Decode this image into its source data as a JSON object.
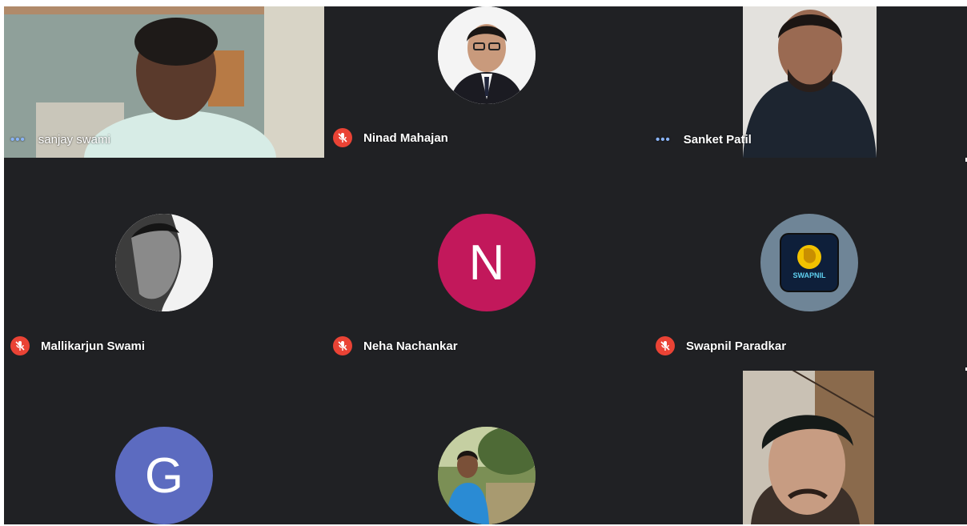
{
  "meeting": {
    "participants": [
      {
        "name": "sanjay swami",
        "status": "speaking",
        "display": "video"
      },
      {
        "name": "Ninad Mahajan",
        "status": "muted",
        "display": "photo"
      },
      {
        "name": "Sanket Patil",
        "status": "speaking",
        "display": "video"
      },
      {
        "name": "Mallikarjun Swami",
        "status": "muted",
        "display": "photo"
      },
      {
        "name": "Neha Nachankar",
        "status": "muted",
        "display": "initial",
        "initial": "N",
        "avatar_color": "#c2185b"
      },
      {
        "name": "Swapnil Paradkar",
        "status": "muted",
        "display": "logo",
        "logo_text": "SWAPNIL"
      },
      {
        "name": "",
        "status": "",
        "display": "initial",
        "initial": "G",
        "avatar_color": "#5c6bc0"
      },
      {
        "name": "",
        "status": "",
        "display": "photo"
      },
      {
        "name": "",
        "status": "",
        "display": "video"
      }
    ]
  },
  "colors": {
    "background": "#202124",
    "mic_off": "#ea4335",
    "speaking_indicator": "#8ab4f8"
  }
}
